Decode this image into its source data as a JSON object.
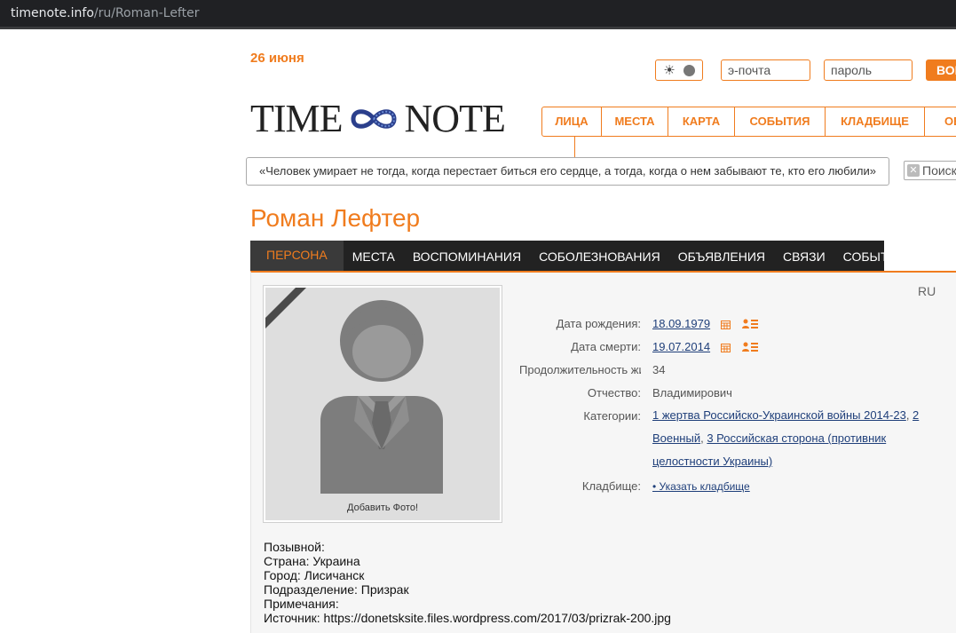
{
  "browser": {
    "url_host": "timenote.info",
    "url_path": "/ru/Roman-Lefter"
  },
  "header": {
    "date": "26 июня",
    "email_placeholder": "э-почта",
    "password_placeholder": "пароль",
    "login_label": "ВОЙТИ",
    "logo_left": "TIME",
    "logo_right": "NOTE"
  },
  "nav": {
    "items": [
      {
        "label": "ЛИЦА"
      },
      {
        "label": "МЕСТА"
      },
      {
        "label": "КАРТА"
      },
      {
        "label": "СОБЫТИЯ"
      },
      {
        "label": "КЛАДБИЩЕ"
      },
      {
        "label": "ОБ"
      }
    ]
  },
  "quote": "«Человек умирает не тогда, когда перестает биться его сердце, а тогда, когда о нем забывают те, кто его любили»",
  "search": {
    "placeholder": "Поиск"
  },
  "person": {
    "name": "Роман Лефтер",
    "tabs": [
      {
        "label": "ПЕРСОНА",
        "active": true
      },
      {
        "label": "МЕСТА"
      },
      {
        "label": "ВОСПОМИНАНИЯ"
      },
      {
        "label": "СОБОЛЕЗНОВАНИЯ"
      },
      {
        "label": "ОБЪЯВЛЕНИЯ"
      },
      {
        "label": "СВЯЗИ"
      },
      {
        "label": "СОБЫТИЯ"
      }
    ],
    "add_photo": "Добавить Фото!",
    "lang": "RU",
    "birth_label": "Дата рождения:",
    "birth_value": "18.09.1979",
    "death_label": "Дата смерти:",
    "death_value": "19.07.2014",
    "duration_label": "Продолжительность жизни:",
    "duration_value": "34",
    "patronymic_label": "Отчество:",
    "patronymic_value": "Владимирович",
    "categories_label": "Категории:",
    "categories": [
      {
        "text": "1 жертва Российско-Украинской войны 2014-23",
        "sep": ", "
      },
      {
        "text": "2 Военный",
        "sep": ", "
      },
      {
        "text": "3 Российская сторона (противник целостности Украины)",
        "sep": ""
      }
    ],
    "cemetery_label": "Кладбище:",
    "cemetery_value": "• Указать кладбище",
    "details": [
      "Позывной:",
      "Страна: Украина",
      "Город: Лисичанск",
      "Подразделение: Призрак",
      "Примечания:",
      "Источник: https://donetsksite.files.wordpress.com/2017/03/prizrak-200.jpg"
    ]
  },
  "colors": {
    "accent": "#f07c1e",
    "tab_bar": "#222222",
    "link": "#1f3f7a"
  }
}
